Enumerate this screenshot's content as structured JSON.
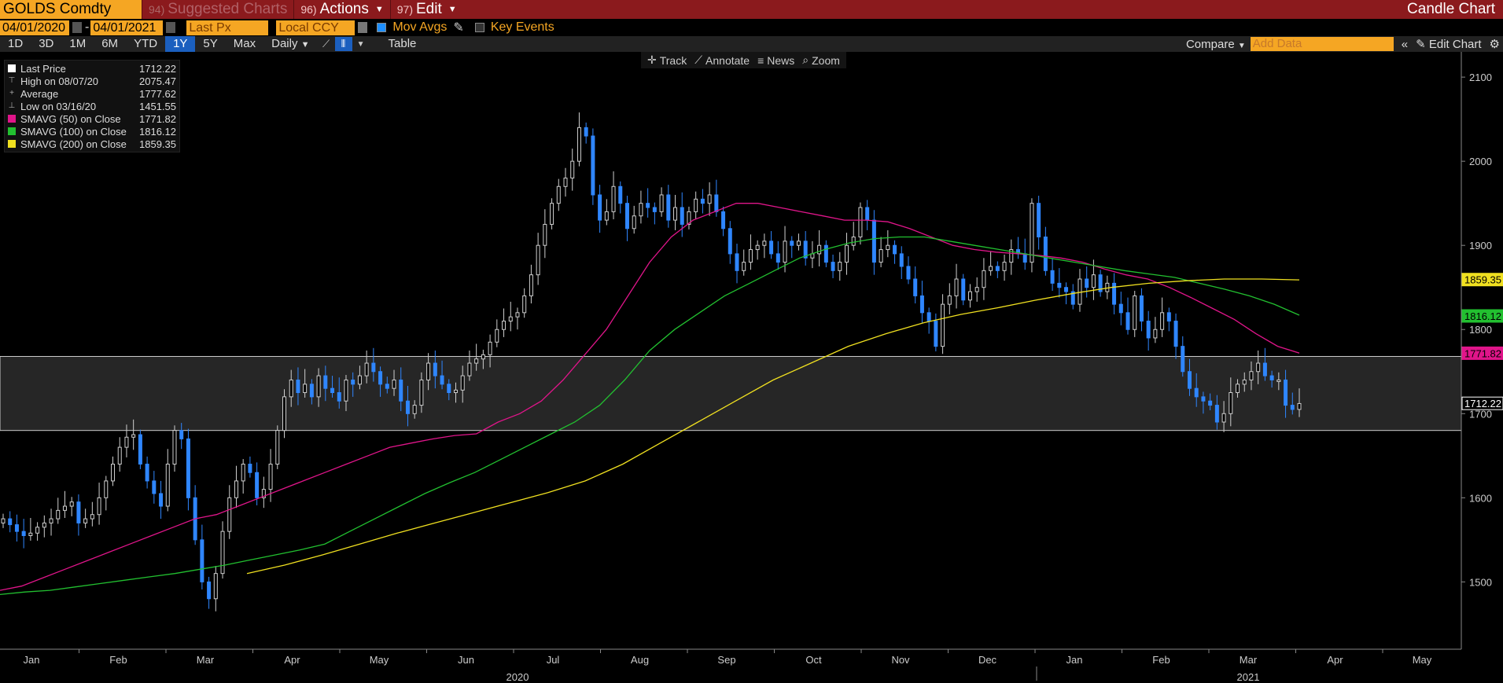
{
  "header": {
    "ticker": "GOLDS Comdty",
    "functions": [
      {
        "num": "94)",
        "label": "Suggested Charts",
        "dim": true
      },
      {
        "num": "96)",
        "label": "Actions",
        "dim": false,
        "caret": true
      },
      {
        "num": "97)",
        "label": "Edit",
        "dim": false,
        "caret": true
      }
    ],
    "title": "Candle Chart"
  },
  "controls": {
    "start_date": "04/01/2020",
    "end_date": "04/01/2021",
    "dash": "-",
    "field": "Last Px",
    "currency": "Local CCY",
    "mov_avgs": "Mov Avgs",
    "key_events": "Key Events"
  },
  "periods": [
    "1D",
    "3D",
    "1M",
    "6M",
    "YTD",
    "1Y",
    "5Y",
    "Max"
  ],
  "active_period": "1Y",
  "frequency": "Daily",
  "table_label": "Table",
  "compare_label": "Compare",
  "add_data_placeholder": "Add Data",
  "edit_chart_label": "Edit Chart",
  "chart_tools": [
    "Track",
    "Annotate",
    "News",
    "Zoom"
  ],
  "legend": [
    {
      "name": "Last Price",
      "value": "1712.22",
      "swatch": "#ffffff"
    },
    {
      "name": "High on 08/07/20",
      "value": "2075.47",
      "swatch": "none"
    },
    {
      "name": "Average",
      "value": "1777.62",
      "swatch": "none"
    },
    {
      "name": "Low on 03/16/20",
      "value": "1451.55",
      "swatch": "none"
    },
    {
      "name": "SMAVG (50)  on Close",
      "value": "1771.82",
      "swatch": "#e0158a"
    },
    {
      "name": "SMAVG (100)  on Close",
      "value": "1816.12",
      "swatch": "#22c030"
    },
    {
      "name": "SMAVG (200)  on Close",
      "value": "1859.35",
      "swatch": "#f0e020"
    }
  ],
  "chart_data": {
    "type": "candlestick",
    "y_ticks": [
      1500,
      1600,
      1700,
      1800,
      1900,
      2000,
      2100
    ],
    "ylim": [
      1420,
      2130
    ],
    "x_month_labels": [
      "Jan",
      "Feb",
      "Mar",
      "Apr",
      "May",
      "Jun",
      "Jul",
      "Aug",
      "Sep",
      "Oct",
      "Nov",
      "Dec",
      "Jan",
      "Feb",
      "Mar",
      "Apr",
      "May"
    ],
    "year_labels": [
      "2020",
      "2021"
    ],
    "last_price": 1712.22,
    "price_labels": [
      {
        "value": 1859.35,
        "text": "1859.35",
        "color": "#f0e020"
      },
      {
        "value": 1816.12,
        "text": "1816.12",
        "color": "#22c030"
      },
      {
        "value": 1771.82,
        "text": "1771.82",
        "color": "#e0158a"
      },
      {
        "value": 1712.22,
        "text": "1712.22",
        "color": "#ffffff"
      }
    ],
    "band": [
      1680,
      1768
    ],
    "close": [
      1575,
      1568,
      1560,
      1555,
      1558,
      1565,
      1570,
      1575,
      1585,
      1590,
      1595,
      1570,
      1575,
      1580,
      1600,
      1620,
      1640,
      1660,
      1672,
      1675,
      1640,
      1620,
      1605,
      1590,
      1640,
      1680,
      1670,
      1600,
      1550,
      1500,
      1480,
      1510,
      1560,
      1600,
      1620,
      1640,
      1630,
      1600,
      1610,
      1640,
      1680,
      1720,
      1740,
      1725,
      1735,
      1720,
      1745,
      1730,
      1725,
      1715,
      1740,
      1735,
      1745,
      1760,
      1750,
      1735,
      1730,
      1740,
      1715,
      1700,
      1710,
      1740,
      1760,
      1745,
      1735,
      1725,
      1728,
      1745,
      1760,
      1765,
      1770,
      1785,
      1800,
      1810,
      1815,
      1820,
      1840,
      1865,
      1900,
      1925,
      1950,
      1970,
      1980,
      2000,
      2040,
      2030,
      1960,
      1930,
      1940,
      1970,
      1950,
      1920,
      1935,
      1950,
      1945,
      1940,
      1960,
      1930,
      1945,
      1925,
      1940,
      1955,
      1950,
      1960,
      1940,
      1920,
      1890,
      1870,
      1880,
      1895,
      1900,
      1905,
      1890,
      1880,
      1905,
      1900,
      1905,
      1885,
      1890,
      1900,
      1880,
      1870,
      1880,
      1900,
      1910,
      1945,
      1930,
      1880,
      1895,
      1900,
      1890,
      1875,
      1860,
      1840,
      1820,
      1810,
      1780,
      1830,
      1840,
      1860,
      1835,
      1845,
      1850,
      1870,
      1875,
      1870,
      1880,
      1895,
      1890,
      1880,
      1950,
      1910,
      1870,
      1855,
      1850,
      1845,
      1830,
      1860,
      1850,
      1865,
      1845,
      1855,
      1830,
      1820,
      1800,
      1840,
      1810,
      1790,
      1800,
      1820,
      1810,
      1780,
      1750,
      1730,
      1720,
      1715,
      1710,
      1690,
      1700,
      1725,
      1735,
      1740,
      1750,
      1760,
      1745,
      1740,
      1740,
      1710,
      1705,
      1712
    ],
    "smavg_50": [
      1490,
      1495,
      1505,
      1515,
      1525,
      1535,
      1545,
      1555,
      1565,
      1575,
      1580,
      1590,
      1600,
      1610,
      1620,
      1630,
      1640,
      1650,
      1660,
      1665,
      1670,
      1674,
      1676,
      1690,
      1700,
      1715,
      1740,
      1770,
      1800,
      1840,
      1880,
      1910,
      1930,
      1940,
      1950,
      1950,
      1945,
      1940,
      1935,
      1930,
      1930,
      1928,
      1920,
      1910,
      1900,
      1895,
      1892,
      1890,
      1888,
      1885,
      1880,
      1872,
      1865,
      1860,
      1850,
      1838,
      1825,
      1812,
      1795,
      1780,
      1772
    ],
    "smavg_100": [
      1485,
      1488,
      1490,
      1494,
      1498,
      1502,
      1506,
      1510,
      1515,
      1520,
      1526,
      1532,
      1538,
      1545,
      1560,
      1575,
      1590,
      1605,
      1618,
      1630,
      1645,
      1660,
      1675,
      1690,
      1710,
      1740,
      1775,
      1800,
      1820,
      1840,
      1855,
      1870,
      1885,
      1895,
      1903,
      1908,
      1910,
      1910,
      1905,
      1900,
      1895,
      1890,
      1885,
      1880,
      1875,
      1870,
      1866,
      1862,
      1855,
      1848,
      1840,
      1830,
      1817
    ],
    "smavg_200": [
      1510,
      1520,
      1532,
      1545,
      1558,
      1570,
      1582,
      1594,
      1606,
      1620,
      1640,
      1665,
      1690,
      1715,
      1740,
      1760,
      1780,
      1795,
      1808,
      1818,
      1826,
      1835,
      1843,
      1850,
      1855,
      1858,
      1860,
      1860,
      1859
    ]
  }
}
